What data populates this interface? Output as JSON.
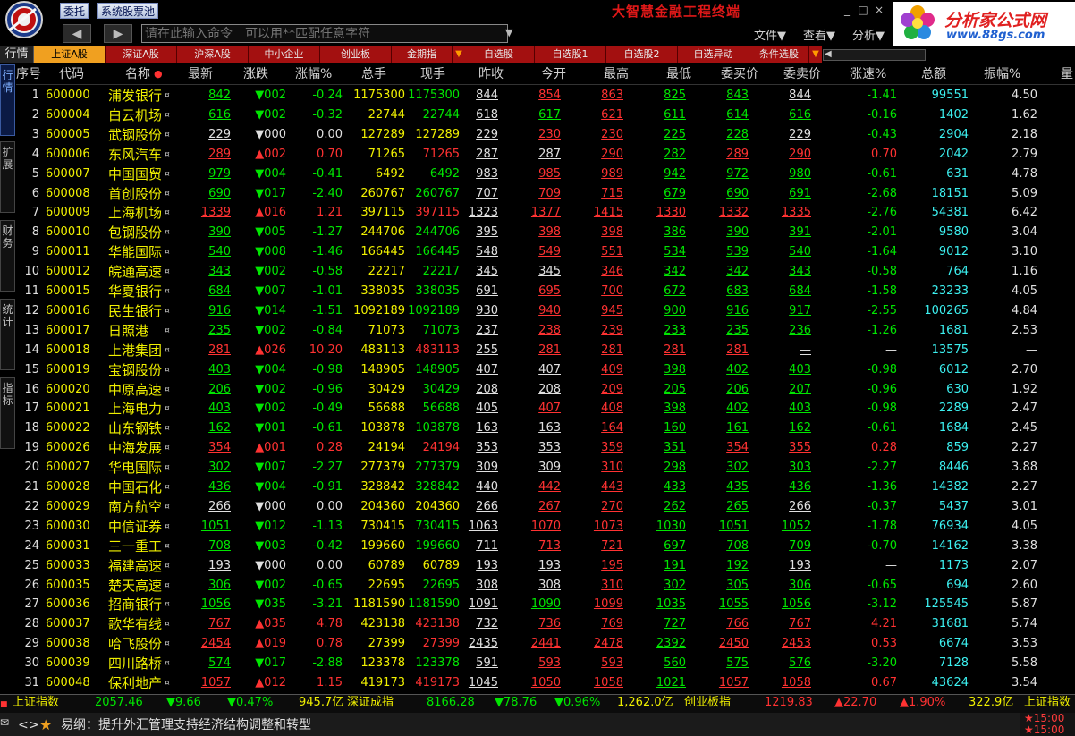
{
  "app": {
    "title": "大智慧金融工程终端",
    "btn_trade": "委托",
    "btn_pool": "系统股票池",
    "command_placeholder": "请在此输入命令　可以用**匹配任意字符",
    "menus": [
      "文件▼",
      "查看▼",
      "分析▼"
    ],
    "brand_name": "分析家公式网",
    "brand_url": "www.88gs.com",
    "win_controls": [
      "_",
      "□",
      "×"
    ]
  },
  "tabs": {
    "hq": "行情",
    "items": [
      "上证A股",
      "深证A股",
      "沪深A股",
      "中小企业",
      "创业板",
      "金期指",
      "自选股",
      "自选股1",
      "自选股2",
      "自选异动",
      "条件选股"
    ],
    "active_index": 0
  },
  "side_tabs": [
    "行情",
    "扩展",
    "财务",
    "统计",
    "指标"
  ],
  "columns": [
    "序号",
    "代码",
    "名称",
    "最新",
    "涨跌",
    "涨幅%",
    "总手",
    "现手",
    "昨收",
    "今开",
    "最高",
    "最低",
    "委买价",
    "委卖价",
    "涨速%",
    "总额",
    "振幅%",
    "量"
  ],
  "rows": [
    [
      "1",
      "600000",
      "浦发银行",
      "842",
      "▼002",
      "-0.24",
      "1175300",
      "1175300",
      "844",
      "854",
      "863",
      "825",
      "843",
      "844",
      "-1.41",
      "99551",
      "4.50"
    ],
    [
      "2",
      "600004",
      "白云机场",
      "616",
      "▼002",
      "-0.32",
      "22744",
      "22744",
      "618",
      "617",
      "621",
      "611",
      "614",
      "616",
      "-0.16",
      "1402",
      "1.62"
    ],
    [
      "3",
      "600005",
      "武钢股份",
      "229",
      "▼000",
      "0.00",
      "127289",
      "127289",
      "229",
      "230",
      "230",
      "225",
      "228",
      "229",
      "-0.43",
      "2904",
      "2.18"
    ],
    [
      "4",
      "600006",
      "东风汽车",
      "289",
      "▲002",
      "0.70",
      "71265",
      "71265",
      "287",
      "287",
      "290",
      "282",
      "289",
      "290",
      "0.70",
      "2042",
      "2.79"
    ],
    [
      "5",
      "600007",
      "中国国贸",
      "979",
      "▼004",
      "-0.41",
      "6492",
      "6492",
      "983",
      "985",
      "989",
      "942",
      "972",
      "980",
      "-0.61",
      "631",
      "4.78"
    ],
    [
      "6",
      "600008",
      "首创股份",
      "690",
      "▼017",
      "-2.40",
      "260767",
      "260767",
      "707",
      "709",
      "715",
      "679",
      "690",
      "691",
      "-2.68",
      "18151",
      "5.09"
    ],
    [
      "7",
      "600009",
      "上海机场",
      "1339",
      "▲016",
      "1.21",
      "397115",
      "397115",
      "1323",
      "1377",
      "1415",
      "1330",
      "1332",
      "1335",
      "-2.76",
      "54381",
      "6.42"
    ],
    [
      "8",
      "600010",
      "包钢股份",
      "390",
      "▼005",
      "-1.27",
      "244706",
      "244706",
      "395",
      "398",
      "398",
      "386",
      "390",
      "391",
      "-2.01",
      "9580",
      "3.04"
    ],
    [
      "9",
      "600011",
      "华能国际",
      "540",
      "▼008",
      "-1.46",
      "166445",
      "166445",
      "548",
      "549",
      "551",
      "534",
      "539",
      "540",
      "-1.64",
      "9012",
      "3.10"
    ],
    [
      "10",
      "600012",
      "皖通高速",
      "343",
      "▼002",
      "-0.58",
      "22217",
      "22217",
      "345",
      "345",
      "346",
      "342",
      "342",
      "343",
      "-0.58",
      "764",
      "1.16"
    ],
    [
      "11",
      "600015",
      "华夏银行",
      "684",
      "▼007",
      "-1.01",
      "338035",
      "338035",
      "691",
      "695",
      "700",
      "672",
      "683",
      "684",
      "-1.58",
      "23233",
      "4.05"
    ],
    [
      "12",
      "600016",
      "民生银行",
      "916",
      "▼014",
      "-1.51",
      "1092189",
      "1092189",
      "930",
      "940",
      "945",
      "900",
      "916",
      "917",
      "-2.55",
      "100265",
      "4.84"
    ],
    [
      "13",
      "600017",
      "日照港",
      "235",
      "▼002",
      "-0.84",
      "71073",
      "71073",
      "237",
      "238",
      "239",
      "233",
      "235",
      "236",
      "-1.26",
      "1681",
      "2.53"
    ],
    [
      "14",
      "600018",
      "上港集团",
      "281",
      "▲026",
      "10.20",
      "483113",
      "483113",
      "255",
      "281",
      "281",
      "281",
      "281",
      "—",
      "—",
      "13575",
      "—"
    ],
    [
      "15",
      "600019",
      "宝钢股份",
      "403",
      "▼004",
      "-0.98",
      "148905",
      "148905",
      "407",
      "407",
      "409",
      "398",
      "402",
      "403",
      "-0.98",
      "6012",
      "2.70"
    ],
    [
      "16",
      "600020",
      "中原高速",
      "206",
      "▼002",
      "-0.96",
      "30429",
      "30429",
      "208",
      "208",
      "209",
      "205",
      "206",
      "207",
      "-0.96",
      "630",
      "1.92"
    ],
    [
      "17",
      "600021",
      "上海电力",
      "403",
      "▼002",
      "-0.49",
      "56688",
      "56688",
      "405",
      "407",
      "408",
      "398",
      "402",
      "403",
      "-0.98",
      "2289",
      "2.47"
    ],
    [
      "18",
      "600022",
      "山东钢铁",
      "162",
      "▼001",
      "-0.61",
      "103878",
      "103878",
      "163",
      "163",
      "164",
      "160",
      "161",
      "162",
      "-0.61",
      "1684",
      "2.45"
    ],
    [
      "19",
      "600026",
      "中海发展",
      "354",
      "▲001",
      "0.28",
      "24194",
      "24194",
      "353",
      "353",
      "359",
      "351",
      "354",
      "355",
      "0.28",
      "859",
      "2.27"
    ],
    [
      "20",
      "600027",
      "华电国际",
      "302",
      "▼007",
      "-2.27",
      "277379",
      "277379",
      "309",
      "309",
      "310",
      "298",
      "302",
      "303",
      "-2.27",
      "8446",
      "3.88"
    ],
    [
      "21",
      "600028",
      "中国石化",
      "436",
      "▼004",
      "-0.91",
      "328842",
      "328842",
      "440",
      "442",
      "443",
      "433",
      "435",
      "436",
      "-1.36",
      "14382",
      "2.27"
    ],
    [
      "22",
      "600029",
      "南方航空",
      "266",
      "▼000",
      "0.00",
      "204360",
      "204360",
      "266",
      "267",
      "270",
      "262",
      "265",
      "266",
      "-0.37",
      "5437",
      "3.01"
    ],
    [
      "23",
      "600030",
      "中信证券",
      "1051",
      "▼012",
      "-1.13",
      "730415",
      "730415",
      "1063",
      "1070",
      "1073",
      "1030",
      "1051",
      "1052",
      "-1.78",
      "76934",
      "4.05"
    ],
    [
      "24",
      "600031",
      "三一重工",
      "708",
      "▼003",
      "-0.42",
      "199660",
      "199660",
      "711",
      "713",
      "721",
      "697",
      "708",
      "709",
      "-0.70",
      "14162",
      "3.38"
    ],
    [
      "25",
      "600033",
      "福建高速",
      "193",
      "▼000",
      "0.00",
      "60789",
      "60789",
      "193",
      "193",
      "195",
      "191",
      "192",
      "193",
      "—",
      "1173",
      "2.07"
    ],
    [
      "26",
      "600035",
      "楚天高速",
      "306",
      "▼002",
      "-0.65",
      "22695",
      "22695",
      "308",
      "308",
      "310",
      "302",
      "305",
      "306",
      "-0.65",
      "694",
      "2.60"
    ],
    [
      "27",
      "600036",
      "招商银行",
      "1056",
      "▼035",
      "-3.21",
      "1181590",
      "1181590",
      "1091",
      "1090",
      "1099",
      "1035",
      "1055",
      "1056",
      "-3.12",
      "125545",
      "5.87"
    ],
    [
      "28",
      "600037",
      "歌华有线",
      "767",
      "▲035",
      "4.78",
      "423138",
      "423138",
      "732",
      "736",
      "769",
      "727",
      "766",
      "767",
      "4.21",
      "31681",
      "5.74"
    ],
    [
      "29",
      "600038",
      "哈飞股份",
      "2454",
      "▲019",
      "0.78",
      "27399",
      "27399",
      "2435",
      "2441",
      "2478",
      "2392",
      "2450",
      "2453",
      "0.53",
      "6674",
      "3.53"
    ],
    [
      "30",
      "600039",
      "四川路桥",
      "574",
      "▼017",
      "-2.88",
      "123378",
      "123378",
      "591",
      "593",
      "593",
      "560",
      "575",
      "576",
      "-3.20",
      "7128",
      "5.58"
    ],
    [
      "31",
      "600048",
      "保利地产",
      "1057",
      "▲012",
      "1.15",
      "419173",
      "419173",
      "1045",
      "1050",
      "1058",
      "1021",
      "1057",
      "1058",
      "0.67",
      "43624",
      "3.54"
    ]
  ],
  "index_bar": {
    "sh_name": "上证指数",
    "sh_value": "2057.46",
    "sh_change": "▼9.66",
    "sh_pct": "▼0.47%",
    "sh_amount": "945.7亿",
    "sz_name": "深证成指",
    "sz_value": "8166.28",
    "sz_change": "▼78.76",
    "sz_pct": "▼0.96%",
    "sz_amount": "1,262.0亿",
    "cy_name": "创业板指",
    "cy_value": "1219.83",
    "cy_change": "▲22.70",
    "cy_pct": "▲1.90%",
    "cy_amount": "322.9亿",
    "sh_name2": "上证指数"
  },
  "news_bar": {
    "prev": "<",
    "next": ">",
    "star": "★",
    "headline": "易纲：提升外汇管理支持经济结构调整和转型",
    "time1": "★15:00",
    "time2": "★15:00"
  },
  "colors": {
    "up": "#ff3232",
    "down": "#00e600",
    "flat": "#e0e0e0",
    "code": "#f0f000",
    "amount": "#3cf0f0",
    "active_tab": "#f0a020",
    "tab_bg": "#a31010"
  }
}
